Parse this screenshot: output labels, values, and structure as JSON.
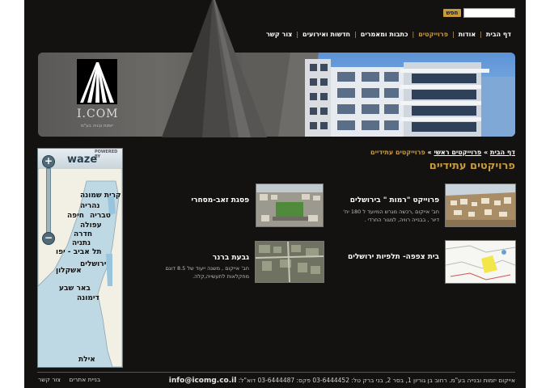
{
  "header": {
    "search_button": "חפש",
    "search_value": ""
  },
  "nav": {
    "items": [
      {
        "label": "דף הבית"
      },
      {
        "label": "אודות"
      },
      {
        "label": "פרוייקטים"
      },
      {
        "label": "כתבות ומאמרים"
      },
      {
        "label": "חדשות ואירועים"
      },
      {
        "label": "צור קשר"
      }
    ],
    "active_index": 2,
    "active_color": "#c89b3c"
  },
  "logo": {
    "text": "I.COM",
    "subtext": "יזמות ובניה בע\"מ"
  },
  "breadcrumb": {
    "home": "דף הבית",
    "sep": "»",
    "parent": "פרוייקטים ראשי",
    "current": "פרוייקטים עתידיים"
  },
  "page_title": "פרויקטים עתידיים",
  "projects": [
    {
      "name": "פרוייקט \"רמות \" בירושלים",
      "desc": "חב' אייקום ,רכשה מגרש המיועד ל 180 יח' דיור , בבנייה רוויה, למגור החרדי ."
    },
    {
      "name": "פסגת זאב-מסחרי",
      "desc": ""
    },
    {
      "name": "בית צפפה- תלפיות ירושלים",
      "desc": ""
    },
    {
      "name": "גבעת ברנר",
      "desc": "חב' אייקום , משנה ייעוד של 8.5 דונם מחקלאות לתעשייה,קלה."
    }
  ],
  "map": {
    "brand": "waze",
    "powered": "POWERED BY",
    "zoom_in": "+",
    "zoom_out": "−",
    "cities": {
      "c1": "קרית שמונה",
      "c2": "נהריה",
      "c3": "טבריה",
      "c4": "חיפה",
      "c5": "עפולה",
      "c6": "חדרה",
      "c7": "נתניה",
      "c8": "תל אביב - יפו",
      "c9": "ירושלים",
      "c10": "אשקלון",
      "c11": "באר שבע",
      "c12": "דימונה",
      "c13": "אילת"
    }
  },
  "footer": {
    "link1": "בניית אתרים",
    "link2": "צור קשר",
    "company": "אייקום יזמות ובנייה בע\"מ. רחוב בן גוריון 1, בסר 2, בני ברק",
    "phone": "טל: 03-6444452",
    "fax": "פקס: 03-6444487",
    "email_label": "דוא\"ל:",
    "email": "info@icomg.co.il"
  }
}
